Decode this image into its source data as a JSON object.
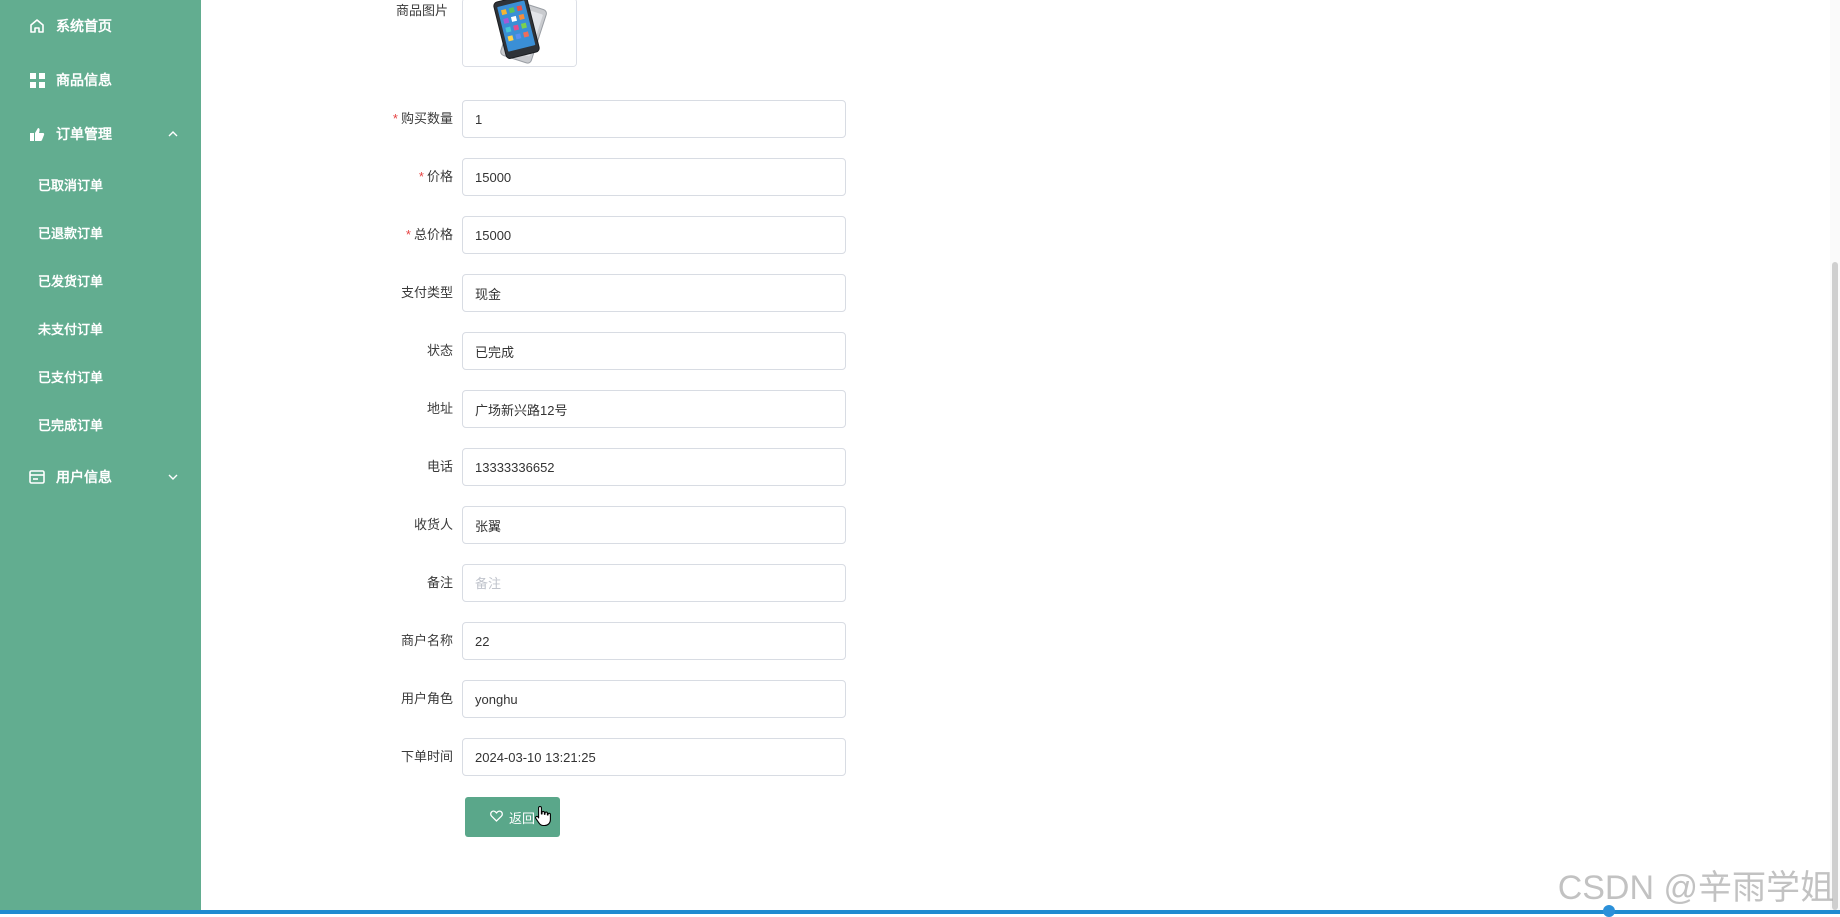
{
  "sidebar": {
    "items": [
      {
        "label": "系统首页",
        "icon": "home-icon"
      },
      {
        "label": "商品信息",
        "icon": "grid-icon"
      },
      {
        "label": "订单管理",
        "icon": "order-icon",
        "expanded": true
      },
      {
        "label": "用户信息",
        "icon": "user-card-icon",
        "expanded": false
      }
    ],
    "submenu": [
      "已取消订单",
      "已退款订单",
      "已发货订单",
      "未支付订单",
      "已支付订单",
      "已完成订单"
    ]
  },
  "form": {
    "image_label": "商品图片",
    "fields": [
      {
        "label": "购买数量",
        "required": true,
        "value": "1",
        "placeholder": ""
      },
      {
        "label": "价格",
        "required": true,
        "value": "15000",
        "placeholder": ""
      },
      {
        "label": "总价格",
        "required": true,
        "value": "15000",
        "placeholder": ""
      },
      {
        "label": "支付类型",
        "required": false,
        "value": "现金",
        "placeholder": ""
      },
      {
        "label": "状态",
        "required": false,
        "value": "已完成",
        "placeholder": ""
      },
      {
        "label": "地址",
        "required": false,
        "value": "广场新兴路12号",
        "placeholder": ""
      },
      {
        "label": "电话",
        "required": false,
        "value": "13333336652",
        "placeholder": ""
      },
      {
        "label": "收货人",
        "required": false,
        "value": "张翼",
        "placeholder": ""
      },
      {
        "label": "备注",
        "required": false,
        "value": "",
        "placeholder": "备注"
      },
      {
        "label": "商户名称",
        "required": false,
        "value": "22",
        "placeholder": ""
      },
      {
        "label": "用户角色",
        "required": false,
        "value": "yonghu",
        "placeholder": ""
      },
      {
        "label": "下单时间",
        "required": false,
        "value": "2024-03-10 13:21:25",
        "placeholder": ""
      }
    ],
    "back_label": "返回"
  },
  "watermark": "CSDN @辛雨学姐",
  "colors": {
    "sidebar": "#62ad90",
    "button": "#5aa78a",
    "required": "#e64242"
  }
}
